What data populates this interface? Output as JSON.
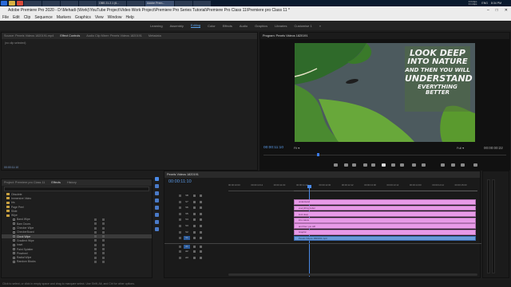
{
  "taskbar": {
    "tabs": [
      "",
      "",
      "",
      "",
      "OBS 21.2.1 (6...",
      "",
      "Adobe Prem...",
      "",
      ""
    ],
    "stats_line1": "0.0 kbps",
    "stats_line2": "0.1 kbps",
    "lang": "ENG",
    "time": "8:34 PM"
  },
  "app": {
    "title": "Adobe Premiere Pro 2020 - D:\\Mehadi (Work)\\YouTube Project\\Video Work Project\\Premiere Pro Series Tutorial\\Premiere Pro Class 11\\Premiere pro Class 11 *"
  },
  "menu": [
    "File",
    "Edit",
    "Clip",
    "Sequence",
    "Markers",
    "Graphics",
    "View",
    "Window",
    "Help"
  ],
  "workspaces": [
    "Learning",
    "Assembly",
    "Editing",
    "Color",
    "Effects",
    "Audio",
    "Graphics",
    "Libraries",
    "Customise 1"
  ],
  "active_workspace": "Editing",
  "source_panel": {
    "tabs": [
      "Source: Pexels Videos 1820191.mp4",
      "Effect Controls",
      "Audio Clip Mixer: Pexels Videos 1820191",
      "Metadata"
    ],
    "active_tab": "Effect Controls",
    "no_clip": "(no clip selected)",
    "timecode": "00:00:11:10"
  },
  "program_monitor": {
    "title": "Program: Pexels Videos 1820191",
    "overlay_lines": [
      "LOOK DEEP",
      "INTO NATURE",
      "AND THEN YOU WILL",
      "UNDERSTAND",
      "EVERYTHING BETTER"
    ],
    "timecode": "00:00:11:10",
    "fit": "Fit",
    "quality": "Full",
    "duration": "00:00:00:22",
    "playhead_fraction": 0.1
  },
  "project_panel": {
    "tabs": [
      "Project: Premiere pro Class 11",
      "Effects",
      "History"
    ],
    "active_tab": "Effects",
    "items": [
      {
        "label": "Obsolete",
        "kind": "folder",
        "selected": false
      },
      {
        "label": "Immersive Video",
        "kind": "folder",
        "selected": false
      },
      {
        "label": "Iris",
        "kind": "folder",
        "selected": false
      },
      {
        "label": "Page Peel",
        "kind": "folder",
        "selected": false
      },
      {
        "label": "Slide",
        "kind": "folder",
        "selected": false
      },
      {
        "label": "Wipe",
        "kind": "folder",
        "selected": false
      },
      {
        "label": "Band Wipe",
        "kind": "effect",
        "selected": false
      },
      {
        "label": "Barn Doors",
        "kind": "effect",
        "selected": false
      },
      {
        "label": "Checker Wipe",
        "kind": "effect",
        "selected": false
      },
      {
        "label": "CheckerBoard",
        "kind": "effect",
        "selected": false
      },
      {
        "label": "Clock Wipe",
        "kind": "effect",
        "selected": true
      },
      {
        "label": "Gradient Wipe",
        "kind": "effect",
        "selected": false
      },
      {
        "label": "Inset",
        "kind": "effect",
        "selected": false
      },
      {
        "label": "Paint Splatter",
        "kind": "effect",
        "selected": false
      },
      {
        "label": "Pinwheel",
        "kind": "effect",
        "selected": false
      },
      {
        "label": "Radial Wipe",
        "kind": "effect",
        "selected": false
      },
      {
        "label": "Random Blocks",
        "kind": "effect",
        "selected": false
      }
    ]
  },
  "timeline": {
    "tab": "Pexels Videos 1820191",
    "timecode": "00:00:11:10",
    "ruler": [
      "00:00:10:00",
      "00:00:10:12",
      "00:00:11:00",
      "00:00:11:12",
      "00:00:12:00",
      "00:00:12:12",
      "00:00:13:00",
      "00:00:13:12",
      "00:00:14:00",
      "00:00:14:12",
      "00:00:15:00"
    ],
    "video_tracks": [
      "V8",
      "V7",
      "V6",
      "V5",
      "V4",
      "V3",
      "V2",
      "V1"
    ],
    "audio_tracks": [
      "A1",
      "A2",
      "A3"
    ],
    "clips": [
      "understand",
      "everything better",
      "look deep",
      "into nature",
      "and then you will",
      "Graphic",
      "Pexels Videos 1820191.mp4"
    ]
  },
  "status": "Click to select, or click in empty space and drag to marquee select. Use Shift, Alt, and Ctrl for other options."
}
